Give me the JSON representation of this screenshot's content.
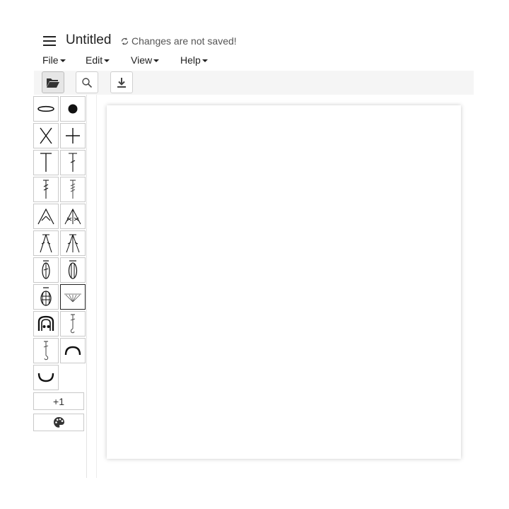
{
  "app": {
    "title": "Untitled",
    "save_status": "Changes are not saved!",
    "save_status_icon": "unsynced-icon"
  },
  "menu": [
    {
      "label": "File"
    },
    {
      "label": "Edit"
    },
    {
      "label": "View"
    },
    {
      "label": "Help"
    }
  ],
  "toolbar": {
    "buttons": [
      {
        "icon": "folder-open-icon",
        "active": true
      },
      {
        "icon": "search-icon",
        "active": false
      },
      {
        "icon": "download-icon",
        "active": false
      }
    ]
  },
  "symbols": [
    {
      "icon": "chain-stitch-icon"
    },
    {
      "icon": "slip-stitch-icon"
    },
    {
      "icon": "single-crochet-x-icon"
    },
    {
      "icon": "single-crochet-plus-icon"
    },
    {
      "icon": "half-double-crochet-icon"
    },
    {
      "icon": "double-crochet-icon"
    },
    {
      "icon": "treble-crochet-icon"
    },
    {
      "icon": "double-treble-crochet-icon"
    },
    {
      "icon": "sc2tog-icon"
    },
    {
      "icon": "sc3tog-icon"
    },
    {
      "icon": "dc2tog-icon"
    },
    {
      "icon": "dc3tog-icon"
    },
    {
      "icon": "puff-stitch-icon"
    },
    {
      "icon": "popcorn-stitch-icon"
    },
    {
      "icon": "bobble-stitch-icon"
    },
    {
      "icon": "shell-stitch-icon",
      "selected": true
    },
    {
      "icon": "picot-icon"
    },
    {
      "icon": "front-post-dc-icon"
    },
    {
      "icon": "back-post-dc-icon"
    },
    {
      "icon": "back-loop-arc-icon"
    },
    {
      "icon": "front-loop-arc-icon"
    }
  ],
  "more_button": {
    "label": "+1"
  },
  "color_button": {
    "icon": "palette-icon"
  },
  "colors": {
    "toolbar_bg": "#f5f5f5",
    "selected_border": "#222222",
    "button_border": "#c9c9c9"
  }
}
